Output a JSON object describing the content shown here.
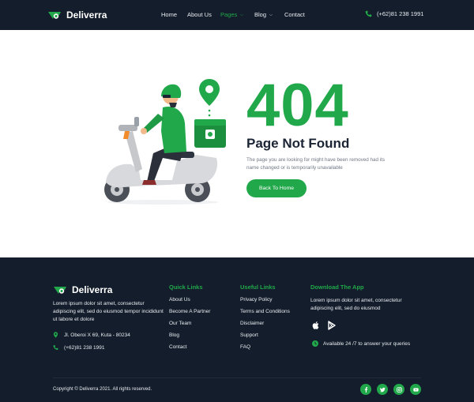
{
  "colors": {
    "brand_green": "#21a84a",
    "dark_navy": "#141d2b",
    "text_dark": "#1b2434",
    "text_muted": "#6f7784"
  },
  "header": {
    "brand_name": "Deliverra",
    "nav": [
      {
        "label": "Home",
        "has_dropdown": false,
        "active": false
      },
      {
        "label": "About Us",
        "has_dropdown": false,
        "active": false
      },
      {
        "label": "Pages",
        "has_dropdown": true,
        "active": true
      },
      {
        "label": "Blog",
        "has_dropdown": true,
        "active": false
      },
      {
        "label": "Contact",
        "has_dropdown": false,
        "active": false
      }
    ],
    "phone": "(+62)81 238 1991",
    "phone_icon": "phone-icon"
  },
  "error_page": {
    "code": "404",
    "title": "Page Not Found",
    "description": "The page you are looking for might have been removed had its name changed or is temporarily unavailable",
    "button_label": "Back To Home",
    "illustration": "delivery-scooter-rider-illustration"
  },
  "footer": {
    "brand_name": "Deliverra",
    "about": "Lorem ipsum dolor sit amet, consectetur adipiscing elit, sed do eiusmod tempor incididunt ut labore et dolore",
    "address": "Jl. Oberoi X 69, Kuta - 80234",
    "phone": "(+62)81 238 1991",
    "quick_links": {
      "title": "Quick Links",
      "items": [
        "About Us",
        "Become A Partner",
        "Our Team",
        "Blog",
        "Contact"
      ]
    },
    "useful_links": {
      "title": "Useful Links",
      "items": [
        "Privacy Policy",
        "Terms and Conditions",
        "Disclaimer",
        "Support",
        "FAQ"
      ]
    },
    "download": {
      "title": "Download The App",
      "text": "Lorem ipsum dolor sit amet, consectetur adipiscing elit, sed do eiusmod",
      "stores": [
        "apple-icon",
        "google-play-icon"
      ],
      "availability": "Available 24 /7 to answer your queries"
    },
    "copyright": "Copyright © Deliverra 2021. All rights reserved.",
    "social": [
      "facebook-icon",
      "twitter-icon",
      "instagram-icon",
      "youtube-icon"
    ]
  }
}
